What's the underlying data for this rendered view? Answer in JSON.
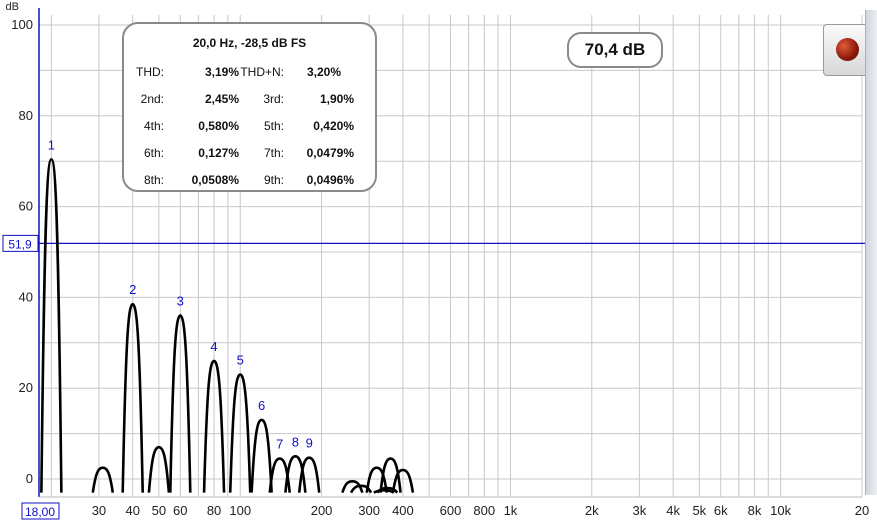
{
  "chart_data": {
    "type": "line",
    "ylabel": "dB",
    "y_scale": "linear",
    "ylim": [
      -3,
      100
    ],
    "y_ticks": [
      "100",
      "80",
      "60",
      "40",
      "20",
      "0"
    ],
    "x_scale": "log",
    "xlim": [
      18,
      20000
    ],
    "x_ticks": [
      "30",
      "40",
      "50",
      "60",
      "80",
      "100",
      "200",
      "300",
      "400",
      "600",
      "800",
      "1k",
      "2k",
      "3k",
      "4k",
      "5k",
      "6k",
      "8k",
      "10k",
      "20"
    ],
    "x_start_label": "18,00",
    "reference_line": {
      "y": 51.9,
      "label": "51,9"
    },
    "grid": true,
    "series": [
      {
        "color": "#000000",
        "peaks": [
          {
            "x": 20,
            "y": 70.4,
            "label": "1"
          },
          {
            "x": 40,
            "y": 38.5,
            "label": "2"
          },
          {
            "x": 60,
            "y": 36.0,
            "label": "3"
          },
          {
            "x": 80,
            "y": 26.0,
            "label": "4"
          },
          {
            "x": 100,
            "y": 23.0,
            "label": "5"
          },
          {
            "x": 120,
            "y": 13.0,
            "label": "6"
          },
          {
            "x": 140,
            "y": 4.5,
            "label": "7"
          },
          {
            "x": 160,
            "y": 5.0,
            "label": "8"
          },
          {
            "x": 180,
            "y": 4.7,
            "label": "9"
          },
          {
            "x": 31,
            "y": 2.5,
            "label": ""
          },
          {
            "x": 50,
            "y": 7.0,
            "label": ""
          },
          {
            "x": 260,
            "y": -0.5,
            "label": ""
          },
          {
            "x": 280,
            "y": -1.5,
            "label": ""
          },
          {
            "x": 320,
            "y": 2.5,
            "label": ""
          },
          {
            "x": 340,
            "y": -2.5,
            "label": ""
          },
          {
            "x": 350,
            "y": -2.0,
            "label": ""
          },
          {
            "x": 360,
            "y": 4.5,
            "label": ""
          },
          {
            "x": 400,
            "y": 2.0,
            "label": ""
          }
        ]
      }
    ]
  },
  "stats": {
    "header": "20,0 Hz, -28,5 dB FS",
    "rows": [
      {
        "l1": "THD:",
        "v1": "3,19%",
        "l2": "THD+N:",
        "v2": "3,20%"
      },
      {
        "l1": "2nd:",
        "v1": "2,45%",
        "l2": "3rd:",
        "v2": "1,90%"
      },
      {
        "l1": "4th:",
        "v1": "0,580%",
        "l2": "5th:",
        "v2": "0,420%"
      },
      {
        "l1": "6th:",
        "v1": "0,127%",
        "l2": "7th:",
        "v2": "0,0479%"
      },
      {
        "l1": "8th:",
        "v1": "0,0508%",
        "l2": "9th:",
        "v2": "0,0496%"
      }
    ]
  },
  "level_readout": "70,4 dB",
  "colors": {
    "trace": "#000000",
    "reference_line": "#1010c8",
    "labels": "#1010c8",
    "grid": "#c8c8c8"
  }
}
